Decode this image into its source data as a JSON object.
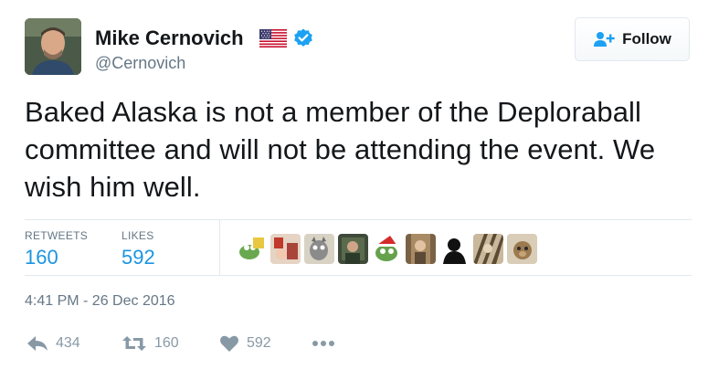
{
  "author": {
    "display_name": "Mike Cernovich",
    "handle": "@Cernovich",
    "flag_icon": "us-flag-icon",
    "verified_icon": "verified-badge-icon",
    "verified_color": "#1da1f2"
  },
  "follow_button": {
    "label": "Follow",
    "icon": "follow-user-plus-icon",
    "icon_color": "#1da1f2"
  },
  "tweet": {
    "text": "Baked Alaska is not a member of the Deploraball committee and will not be attending the event. We wish him well."
  },
  "stats": {
    "retweets_label": "RETWEETS",
    "retweets_value": "160",
    "likes_label": "LIKES",
    "likes_value": "592",
    "value_color": "#1b95e0"
  },
  "likers": [
    "liker-avatar-1",
    "liker-avatar-2",
    "liker-avatar-3",
    "liker-avatar-4",
    "liker-avatar-5",
    "liker-avatar-6",
    "liker-avatar-7",
    "liker-avatar-8",
    "liker-avatar-9"
  ],
  "timestamp": "4:41 PM - 26 Dec 2016",
  "actions": {
    "reply_count": "434",
    "retweet_count": "160",
    "like_count": "592",
    "icon_color": "#8899a6"
  }
}
